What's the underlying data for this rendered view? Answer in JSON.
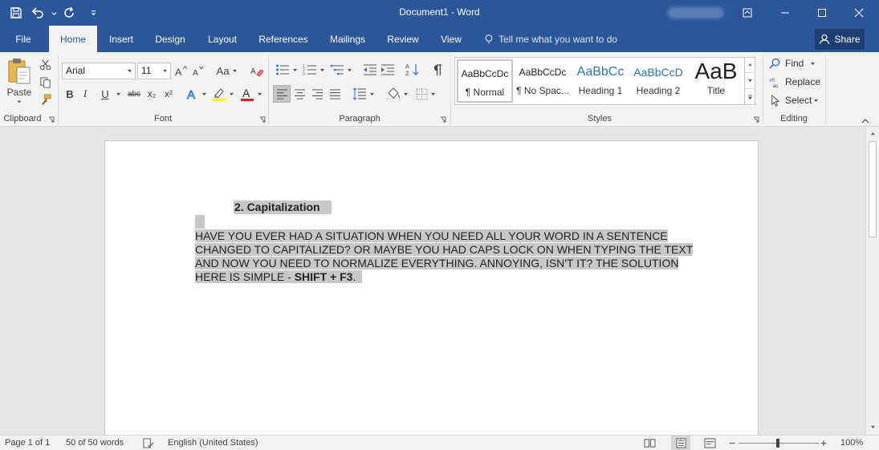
{
  "window": {
    "title": "Document1 - Word"
  },
  "quick_access": {
    "icons": [
      "save-icon",
      "undo-icon",
      "redo-icon",
      "customize-icon"
    ]
  },
  "tabs": [
    {
      "label": "File",
      "active": false
    },
    {
      "label": "Home",
      "active": true
    },
    {
      "label": "Insert",
      "active": false
    },
    {
      "label": "Design",
      "active": false
    },
    {
      "label": "Layout",
      "active": false
    },
    {
      "label": "References",
      "active": false
    },
    {
      "label": "Mailings",
      "active": false
    },
    {
      "label": "Review",
      "active": false
    },
    {
      "label": "View",
      "active": false
    }
  ],
  "tell_me": {
    "placeholder": "Tell me what you want to do"
  },
  "share_label": "Share",
  "ribbon": {
    "clipboard": {
      "label": "Clipboard",
      "paste_label": "Paste"
    },
    "font": {
      "label": "Font",
      "font_name": "Arial",
      "font_size": "11",
      "change_case_label": "Aa",
      "bold": "B",
      "italic": "I",
      "underline": "U",
      "strikethrough": "abc",
      "subscript": "x₂",
      "superscript": "x²",
      "highlight_color": "#ffff00",
      "font_color": "#e02020"
    },
    "paragraph": {
      "label": "Paragraph"
    },
    "styles": {
      "label": "Styles",
      "items": [
        {
          "preview": "AaBbCcDc",
          "name": "¶ Normal",
          "selected": true
        },
        {
          "preview": "AaBbCcDc",
          "name": "¶ No Spac...",
          "selected": false
        },
        {
          "preview": "AaBbCc",
          "name": "Heading 1",
          "selected": false
        },
        {
          "preview": "AaBbCcD",
          "name": "Heading 2",
          "selected": false
        },
        {
          "preview": "AaB",
          "name": "Title",
          "selected": false
        }
      ]
    },
    "editing": {
      "label": "Editing",
      "find": "Find",
      "replace": "Replace",
      "select": "Select"
    }
  },
  "document": {
    "heading": "2. Capitalization",
    "paragraph_text": "HAVE YOU EVER HAD A SITUATION WHEN YOU NEED ALL YOUR WORD IN A SENTENCE CHANGED TO CAPITALIZED? OR MAYBE YOU HAD CAPS LOCK ON WHEN TYPING THE TEXT AND NOW YOU NEED TO NORMALIZE EVERYTHING. ANNOYING, ISN'T IT? THE SOLUTION HERE IS SIMPLE - ",
    "shortcut": "SHIFT + F3",
    "trailing": "."
  },
  "status": {
    "page": "Page 1 of 1",
    "words": "50 of 50 words",
    "language": "English (United States)",
    "zoom": "100%"
  },
  "colors": {
    "brand": "#2b579a",
    "selection": "#c8c8c8"
  }
}
